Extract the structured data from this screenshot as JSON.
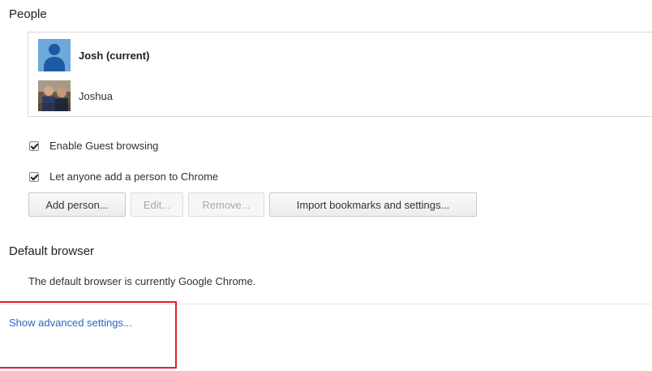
{
  "people": {
    "title": "People",
    "profiles": [
      {
        "name": "Josh (current)",
        "avatar": "default-person-icon"
      },
      {
        "name": "Joshua",
        "avatar": "photo-avatar"
      }
    ],
    "options": [
      {
        "label": "Enable Guest browsing",
        "checked": true
      },
      {
        "label": "Let anyone add a person to Chrome",
        "checked": true
      }
    ],
    "buttons": {
      "add": "Add person...",
      "edit": "Edit...",
      "remove": "Remove...",
      "import": "Import bookmarks and settings..."
    }
  },
  "default_browser": {
    "title": "Default browser",
    "status": "The default browser is currently Google Chrome."
  },
  "advanced_link": "Show advanced settings...",
  "colors": {
    "link": "#2b66c4",
    "highlight": "#e0202a",
    "avatar_bg": "#6ea8dc"
  }
}
